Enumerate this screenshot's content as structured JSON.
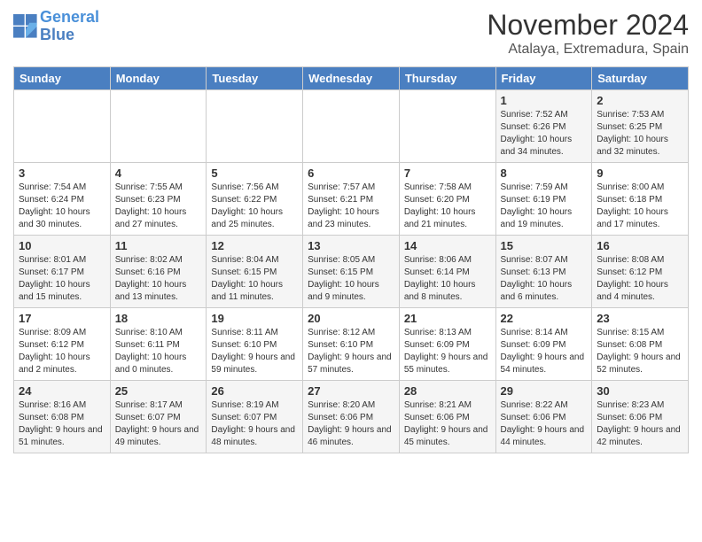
{
  "logo": {
    "line1": "General",
    "line2": "Blue"
  },
  "title": "November 2024",
  "location": "Atalaya, Extremadura, Spain",
  "weekdays": [
    "Sunday",
    "Monday",
    "Tuesday",
    "Wednesday",
    "Thursday",
    "Friday",
    "Saturday"
  ],
  "weeks": [
    [
      {
        "day": "",
        "info": ""
      },
      {
        "day": "",
        "info": ""
      },
      {
        "day": "",
        "info": ""
      },
      {
        "day": "",
        "info": ""
      },
      {
        "day": "",
        "info": ""
      },
      {
        "day": "1",
        "info": "Sunrise: 7:52 AM\nSunset: 6:26 PM\nDaylight: 10 hours and 34 minutes."
      },
      {
        "day": "2",
        "info": "Sunrise: 7:53 AM\nSunset: 6:25 PM\nDaylight: 10 hours and 32 minutes."
      }
    ],
    [
      {
        "day": "3",
        "info": "Sunrise: 7:54 AM\nSunset: 6:24 PM\nDaylight: 10 hours and 30 minutes."
      },
      {
        "day": "4",
        "info": "Sunrise: 7:55 AM\nSunset: 6:23 PM\nDaylight: 10 hours and 27 minutes."
      },
      {
        "day": "5",
        "info": "Sunrise: 7:56 AM\nSunset: 6:22 PM\nDaylight: 10 hours and 25 minutes."
      },
      {
        "day": "6",
        "info": "Sunrise: 7:57 AM\nSunset: 6:21 PM\nDaylight: 10 hours and 23 minutes."
      },
      {
        "day": "7",
        "info": "Sunrise: 7:58 AM\nSunset: 6:20 PM\nDaylight: 10 hours and 21 minutes."
      },
      {
        "day": "8",
        "info": "Sunrise: 7:59 AM\nSunset: 6:19 PM\nDaylight: 10 hours and 19 minutes."
      },
      {
        "day": "9",
        "info": "Sunrise: 8:00 AM\nSunset: 6:18 PM\nDaylight: 10 hours and 17 minutes."
      }
    ],
    [
      {
        "day": "10",
        "info": "Sunrise: 8:01 AM\nSunset: 6:17 PM\nDaylight: 10 hours and 15 minutes."
      },
      {
        "day": "11",
        "info": "Sunrise: 8:02 AM\nSunset: 6:16 PM\nDaylight: 10 hours and 13 minutes."
      },
      {
        "day": "12",
        "info": "Sunrise: 8:04 AM\nSunset: 6:15 PM\nDaylight: 10 hours and 11 minutes."
      },
      {
        "day": "13",
        "info": "Sunrise: 8:05 AM\nSunset: 6:15 PM\nDaylight: 10 hours and 9 minutes."
      },
      {
        "day": "14",
        "info": "Sunrise: 8:06 AM\nSunset: 6:14 PM\nDaylight: 10 hours and 8 minutes."
      },
      {
        "day": "15",
        "info": "Sunrise: 8:07 AM\nSunset: 6:13 PM\nDaylight: 10 hours and 6 minutes."
      },
      {
        "day": "16",
        "info": "Sunrise: 8:08 AM\nSunset: 6:12 PM\nDaylight: 10 hours and 4 minutes."
      }
    ],
    [
      {
        "day": "17",
        "info": "Sunrise: 8:09 AM\nSunset: 6:12 PM\nDaylight: 10 hours and 2 minutes."
      },
      {
        "day": "18",
        "info": "Sunrise: 8:10 AM\nSunset: 6:11 PM\nDaylight: 10 hours and 0 minutes."
      },
      {
        "day": "19",
        "info": "Sunrise: 8:11 AM\nSunset: 6:10 PM\nDaylight: 9 hours and 59 minutes."
      },
      {
        "day": "20",
        "info": "Sunrise: 8:12 AM\nSunset: 6:10 PM\nDaylight: 9 hours and 57 minutes."
      },
      {
        "day": "21",
        "info": "Sunrise: 8:13 AM\nSunset: 6:09 PM\nDaylight: 9 hours and 55 minutes."
      },
      {
        "day": "22",
        "info": "Sunrise: 8:14 AM\nSunset: 6:09 PM\nDaylight: 9 hours and 54 minutes."
      },
      {
        "day": "23",
        "info": "Sunrise: 8:15 AM\nSunset: 6:08 PM\nDaylight: 9 hours and 52 minutes."
      }
    ],
    [
      {
        "day": "24",
        "info": "Sunrise: 8:16 AM\nSunset: 6:08 PM\nDaylight: 9 hours and 51 minutes."
      },
      {
        "day": "25",
        "info": "Sunrise: 8:17 AM\nSunset: 6:07 PM\nDaylight: 9 hours and 49 minutes."
      },
      {
        "day": "26",
        "info": "Sunrise: 8:19 AM\nSunset: 6:07 PM\nDaylight: 9 hours and 48 minutes."
      },
      {
        "day": "27",
        "info": "Sunrise: 8:20 AM\nSunset: 6:06 PM\nDaylight: 9 hours and 46 minutes."
      },
      {
        "day": "28",
        "info": "Sunrise: 8:21 AM\nSunset: 6:06 PM\nDaylight: 9 hours and 45 minutes."
      },
      {
        "day": "29",
        "info": "Sunrise: 8:22 AM\nSunset: 6:06 PM\nDaylight: 9 hours and 44 minutes."
      },
      {
        "day": "30",
        "info": "Sunrise: 8:23 AM\nSunset: 6:06 PM\nDaylight: 9 hours and 42 minutes."
      }
    ]
  ]
}
